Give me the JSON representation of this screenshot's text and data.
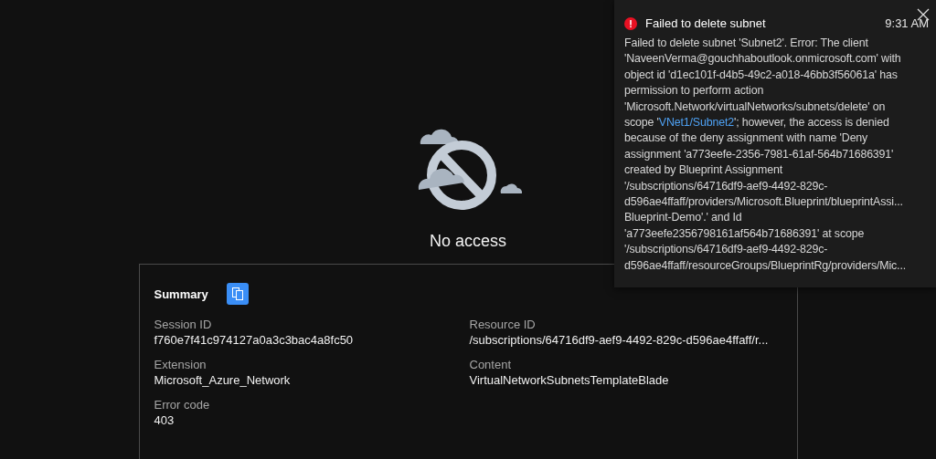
{
  "message": {
    "title": "No access"
  },
  "summary": {
    "title": "Summary",
    "fields": [
      {
        "label": "Session ID",
        "value": "f760e7f41c974127a0a3c3bac4a8fc50"
      },
      {
        "label": "Resource ID",
        "value": "/subscriptions/64716df9-aef9-4492-829c-d596ae4ffaff/r..."
      },
      {
        "label": "Extension",
        "value": "Microsoft_Azure_Network"
      },
      {
        "label": "Content",
        "value": "VirtualNetworkSubnetsTemplateBlade"
      },
      {
        "label": "Error code",
        "value": "403"
      }
    ]
  },
  "notification": {
    "title": "Failed to delete subnet",
    "time": "9:31 AM",
    "before": "Failed to delete subnet 'Subnet2'. Error: The client\n'NaveenVerma@gouchhaboutlook.onmicrosoft.com' with\nobject id 'd1ec101f-d4b5-49c2-a018-46bb3f56061a' has\npermission to perform action\n'Microsoft.Network/virtualNetworks/subnets/delete' on\nscope '",
    "link": "VNet1/Subnet2",
    "after": "'; however, the access is denied\nbecause of the deny assignment with name 'Deny\nassignment 'a773eefe-2356-7981-61af-564b71686391'\ncreated by Blueprint Assignment\n'/subscriptions/64716df9-aef9-4492-829c-\nd596ae4ffaff/providers/Microsoft.Blueprint/blueprintAssi...\nBlueprint-Demo'.' and Id\n'a773eefe2356798161af564b71686391' at scope\n'/subscriptions/64716df9-aef9-4492-829c-\nd596ae4ffaff/resourceGroups/BlueprintRg/providers/Mic..."
  }
}
